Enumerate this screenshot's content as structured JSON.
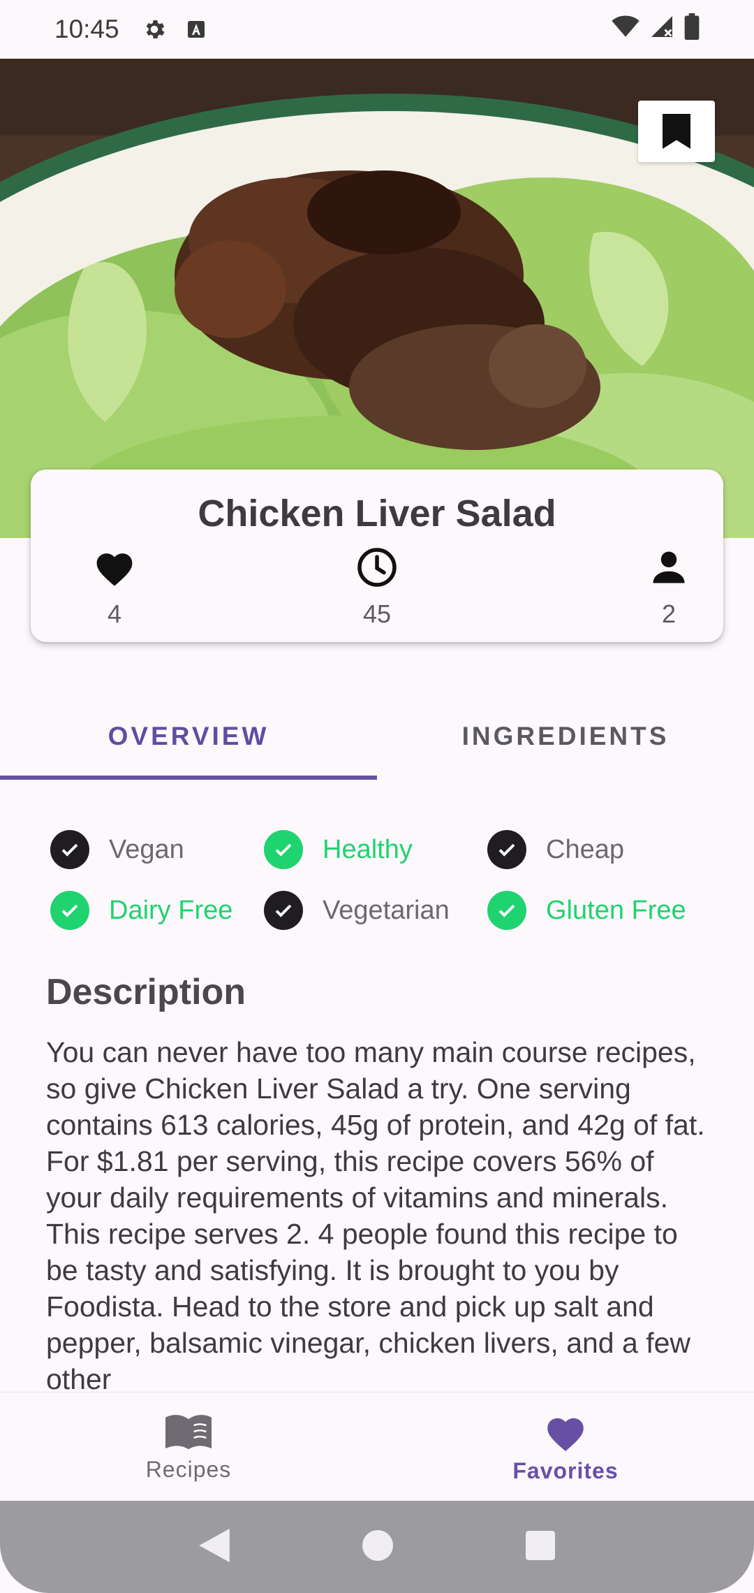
{
  "status_bar": {
    "time": "10:45",
    "icons_left": [
      "settings-icon",
      "accessibility-a-icon"
    ],
    "icons_right": [
      "wifi-icon",
      "cell-signal-icon",
      "battery-icon"
    ]
  },
  "recipe": {
    "title": "Chicken Liver Salad",
    "bookmark_icon": "bookmark-icon",
    "stats": {
      "likes": "4",
      "minutes": "45",
      "servings": "2"
    }
  },
  "tabs": [
    {
      "label": "OVERVIEW",
      "active": true
    },
    {
      "label": "INGREDIENTS",
      "active": false
    }
  ],
  "diets": [
    {
      "label": "Vegan",
      "checked": false
    },
    {
      "label": "Healthy",
      "checked": true
    },
    {
      "label": "Cheap",
      "checked": false
    },
    {
      "label": "Dairy Free",
      "checked": true
    },
    {
      "label": "Vegetarian",
      "checked": false
    },
    {
      "label": "Gluten Free",
      "checked": true
    }
  ],
  "description": {
    "heading": "Description",
    "body": "You can never have too many main course recipes, so give Chicken Liver Salad a try. One serving contains 613 calories, 45g of protein, and 42g of fat. For $1.81 per serving, this recipe covers 56% of your daily requirements of vitamins and minerals. This recipe serves 2. 4 people found this recipe to be tasty and satisfying. It is brought to you by Foodista. Head to the store and pick up salt and pepper, balsamic vinegar, chicken livers, and a few other"
  },
  "bottom_nav": [
    {
      "label": "Recipes",
      "icon": "book-icon",
      "active": false
    },
    {
      "label": "Favorites",
      "icon": "heart-icon",
      "active": true
    }
  ],
  "colors": {
    "accent": "#6750a4",
    "checked_green": "#1fd36f",
    "unchecked_dark": "#1f1d22"
  }
}
